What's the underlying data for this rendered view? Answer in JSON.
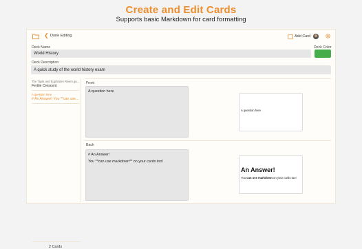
{
  "banner": {
    "title": "Create and Edit Cards",
    "subtitle": "Supports basic Markdown for card formatting"
  },
  "toolbar": {
    "back_label": "Done Editing",
    "add_card_label": "Add Card"
  },
  "deck": {
    "name_label": "Deck Name",
    "name_value": "World History",
    "color_label": "Deck Color",
    "color_value": "#45ad4a",
    "description_label": "Deck Description",
    "description_value": "A quick study of the world history exam"
  },
  "sidebar": {
    "cards": [
      {
        "question": "The Tigris and Euphrates Rivers ga...",
        "answer": "Fertile Crescent",
        "active": false
      },
      {
        "question": "A question here",
        "answer": "# An Answer! You **can use...",
        "active": true
      }
    ],
    "count_label": "2 Cards"
  },
  "editor": {
    "front_label": "Front",
    "front_text": "A question here",
    "back_label": "Back",
    "back_lines": [
      "# An Answer!",
      "You **can use markdown** on your cards too!"
    ]
  },
  "preview": {
    "front_text": "A question here",
    "back_heading": "An Answer!",
    "back_body_pre": "You ",
    "back_body_bold": "can use markdown",
    "back_body_post": " on your cards too!"
  }
}
